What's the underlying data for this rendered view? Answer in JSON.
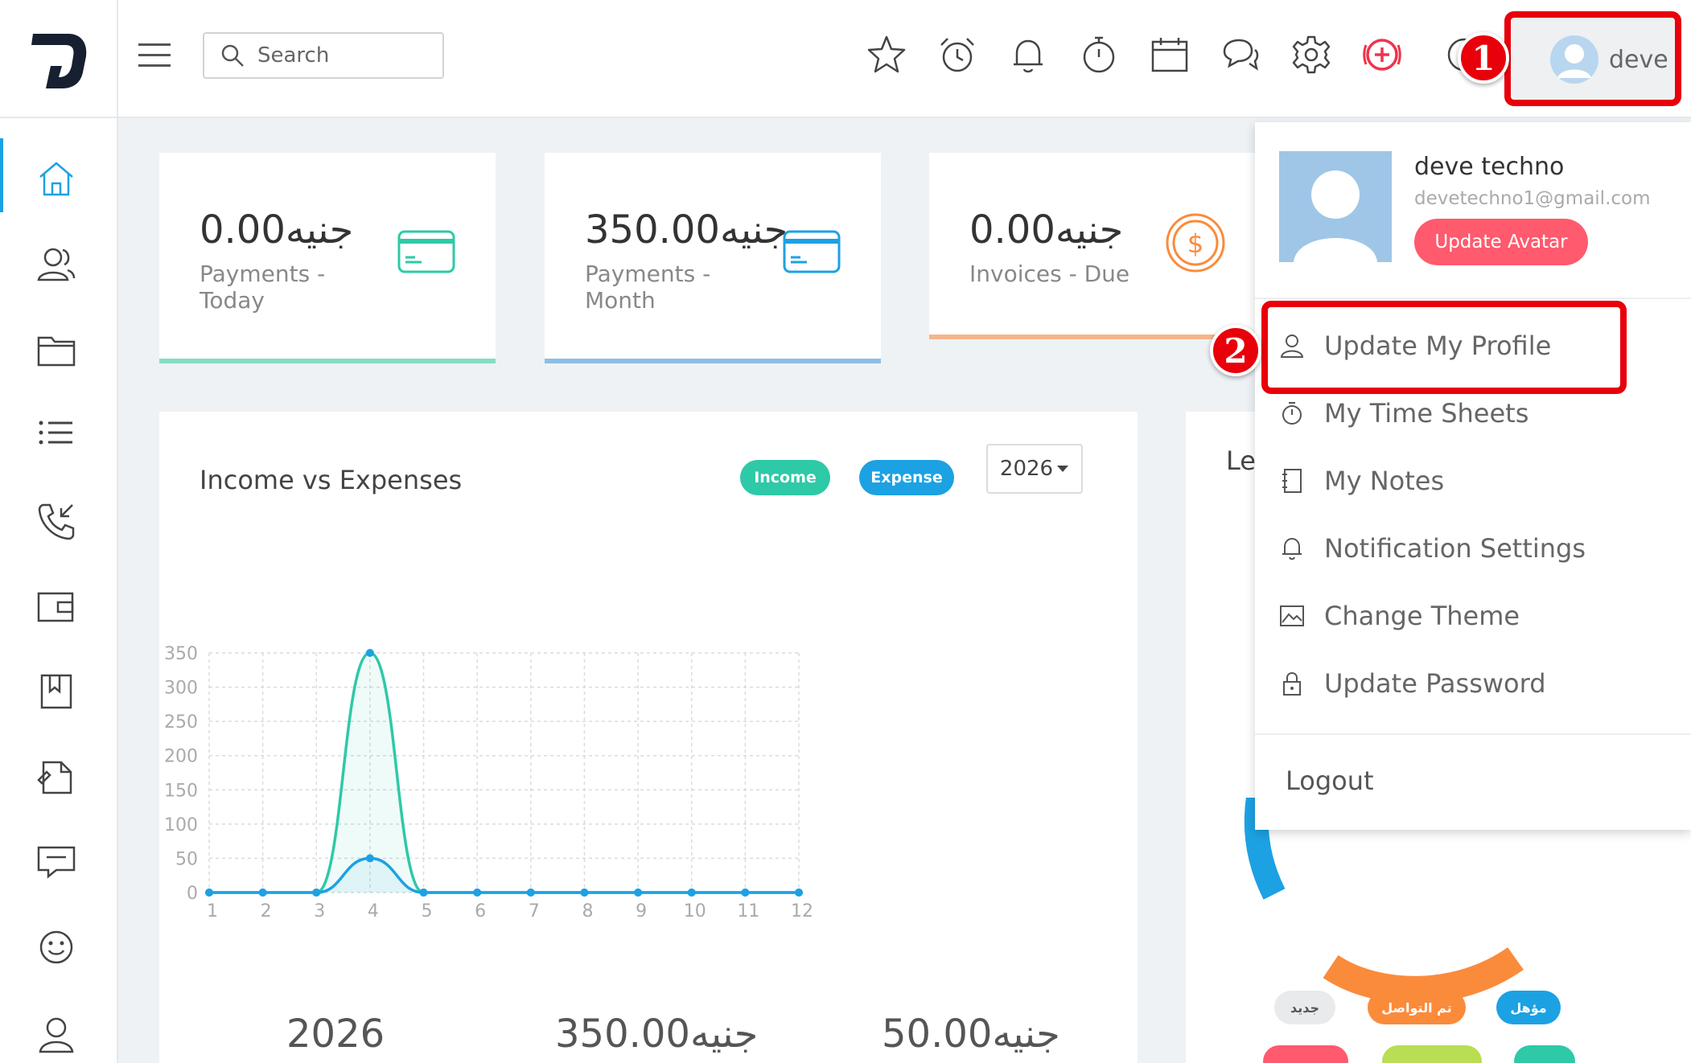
{
  "header": {
    "search_placeholder": "Search",
    "user_name": "deve",
    "icons": [
      "star-icon",
      "alarm-icon",
      "bell-icon",
      "stopwatch-icon",
      "calendar-icon",
      "chat-icon",
      "gear-icon",
      "add-circle-icon",
      "globe-icon"
    ]
  },
  "annotations": {
    "step1": "1",
    "step2": "2"
  },
  "sidebar": {
    "items": [
      "home-icon",
      "users-icon",
      "folder-icon",
      "list-icon",
      "phone-icon",
      "wallet-icon",
      "bookmark-icon",
      "contract-icon",
      "support-icon",
      "smile-icon",
      "user-icon"
    ]
  },
  "stats": [
    {
      "value": "0.00جنيه",
      "label": "Payments - Today",
      "accent": "#85dcc6"
    },
    {
      "value": "350.00جنيه",
      "label": "Payments - Month",
      "accent": "#8cbfe6"
    },
    {
      "value": "0.00جنيه",
      "label": "Invoices - Due",
      "accent": "#f5b58a"
    }
  ],
  "income_chart": {
    "title": "Income vs Expenses",
    "legend_income": "Income",
    "legend_expense": "Expense",
    "year": "2026",
    "bottom_year": "2026",
    "bottom_income": "350.00جنيه",
    "bottom_expense": "50.00جنيه"
  },
  "leads_card": {
    "title_fragment": "Le",
    "pills": [
      "جديد",
      "تم التواصل",
      "مؤهل"
    ]
  },
  "chart_data": {
    "type": "line",
    "categories": [
      "1",
      "2",
      "3",
      "4",
      "5",
      "6",
      "7",
      "8",
      "9",
      "10",
      "11",
      "12"
    ],
    "series": [
      {
        "values": [
          0,
          0,
          0,
          350,
          0,
          0,
          0,
          0,
          0,
          0,
          0,
          0
        ],
        "color": "#2ec9a7"
      },
      {
        "values": [
          0,
          0,
          0,
          50,
          0,
          0,
          0,
          0,
          0,
          0,
          0,
          0
        ],
        "color": "#1ca1e3"
      }
    ],
    "yticks": [
      "350",
      "300",
      "250",
      "200",
      "150",
      "100",
      "50",
      "0"
    ],
    "ylim": [
      0,
      350
    ],
    "grid": true
  },
  "dropdown": {
    "name": "deve techno",
    "email": "devetechno1@gmail.com",
    "update_avatar": "Update Avatar",
    "items": [
      {
        "label": "Update My Profile",
        "icon": "user-icon"
      },
      {
        "label": "My Time Sheets",
        "icon": "stopwatch-icon"
      },
      {
        "label": "My Notes",
        "icon": "notebook-icon"
      },
      {
        "label": "Notification Settings",
        "icon": "bell-icon"
      },
      {
        "label": "Change Theme",
        "icon": "image-icon"
      },
      {
        "label": "Update Password",
        "icon": "lock-icon"
      }
    ],
    "logout": "Logout"
  }
}
